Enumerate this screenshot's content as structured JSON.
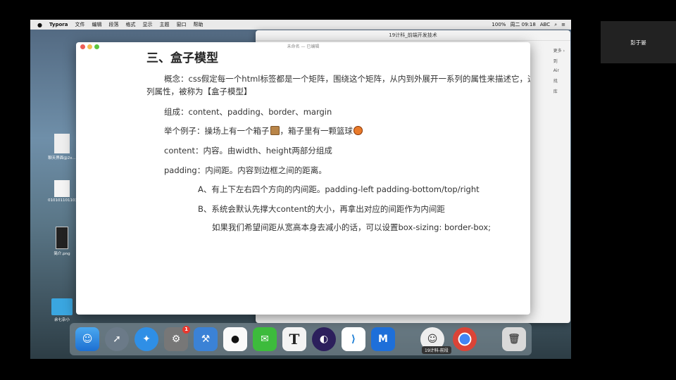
{
  "menubar": {
    "app_name": "Typora",
    "items": [
      "文件",
      "编辑",
      "段落",
      "格式",
      "显示",
      "主题",
      "窗口",
      "帮助"
    ],
    "status": {
      "battery": "100%",
      "clock": "周二 09:18",
      "input": "ABC"
    }
  },
  "bg_window": {
    "title": "19计科_前端开发技术",
    "side_more": "更多 ›",
    "side_items": [
      "到",
      "Air",
      "找",
      "库"
    ]
  },
  "editor": {
    "doc_title": "未命名 — 已编辑",
    "heading": "三、盒子模型",
    "para_concept_line1": "概念：css假定每一个html标签都是一个矩阵，围绕这个矩阵，从内到外展开一系列的属性来描述它，这",
    "para_concept_line2": "列属性，被称为【盒子模型】",
    "para_composition": "组成：content、padding、border、margin",
    "para_example_pre": "举个例子：操场上有一个箱子",
    "para_example_mid": "，箱子里有一颗篮球",
    "para_content": "content：内容。由width、height两部分组成",
    "para_padding": "padding：内间距。内容到边框之间的距离。",
    "item_a": "A、有上下左右四个方向的内间距。padding-left  padding-bottom/top/right",
    "item_b": "B、系统会默认先撑大content的大小，再拿出对应的间距作为内间距",
    "item_tip": "如果我们希望间距从宽高本身去减小的话，可以设置box-sizing: border-box;"
  },
  "desktop": [
    {
      "label": "聊天界面@2x..."
    },
    {
      "label": "0101011011034431711361"
    },
    {
      "label": "简介.png"
    },
    {
      "label": "余七杂小"
    }
  ],
  "dock": {
    "settings_badge": "1",
    "typora_glyph": "T",
    "tooltip": "19计科-前段"
  },
  "participant": {
    "name": "彭于晏"
  }
}
